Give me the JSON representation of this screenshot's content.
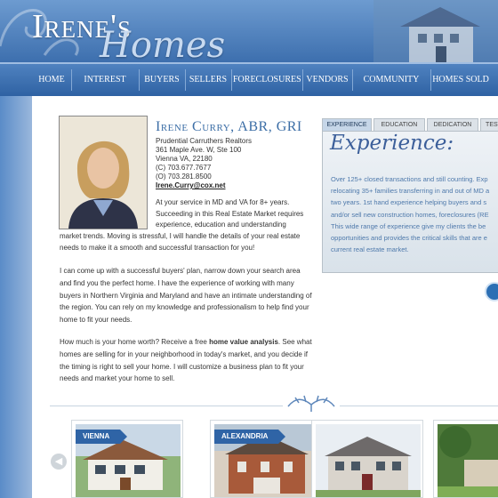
{
  "header": {
    "logo_top": "Irene's",
    "logo_bottom": "Homes"
  },
  "nav": {
    "items": [
      "HOME",
      "INTEREST RATE",
      "BUYERS",
      "SELLERS",
      "FORECLOSURES",
      "VENDORS",
      "COMMUNITY INFO",
      "HOMES SOLD"
    ]
  },
  "agent": {
    "name": "Irene Curry, ABR, GRI",
    "company": "Prudential Carruthers Realtors",
    "address1": "361 Maple Ave. W, Ste 100",
    "address2": "Vienna VA, 22180",
    "phone_c": "(C) 703.677.7677",
    "phone_o": "(O) 703.281.8500",
    "email": "Irene.Curry@cox.net"
  },
  "intro": {
    "part1": "At your service in MD and VA for 8+ years. Succeeding in this Real Estate Market requires experience, education and understanding",
    "part2": "market trends. Moving is stressful, I will handle the details of your real estate needs to make it a smooth and successful transaction for you!"
  },
  "paragraph2": "I can come up with a successful buyers' plan, narrow down your search area and find you the perfect home. I have the experience of working with many buyers in Northern Virginia and Maryland and have an intimate understanding of the region. You can rely on my knowledge and professionalism to help find your home to fit your needs.",
  "paragraph3": {
    "before": "How much is your home worth? Receive a free ",
    "bold": "home value analysis",
    "after": ". See what homes are selling for in your neighborhood in today's market, and you decide if the timing is right to sell your home. I will customize a business plan to fit your needs and market your home to sell."
  },
  "tabs": [
    "EXPERIENCE",
    "EDUCATION",
    "DEDICATION",
    "TEST"
  ],
  "panel": {
    "title": "Experience:",
    "lines": [
      "Over 125+ closed transactions and still counting. Exp",
      "relocating 35+ families transferring in and out of MD a",
      "two years. 1st hand experience helping buyers and s",
      "and/or sell new construction homes, foreclosures (RE",
      "This wide range of experience give my clients the be",
      "opportunities and provides the critical skills that are e",
      "current real estate market."
    ]
  },
  "carousel": {
    "labels": [
      "VIENNA",
      "ALEXANDRIA"
    ]
  },
  "colors": {
    "accent": "#3c6ea6",
    "nav": "#3a6caf"
  }
}
